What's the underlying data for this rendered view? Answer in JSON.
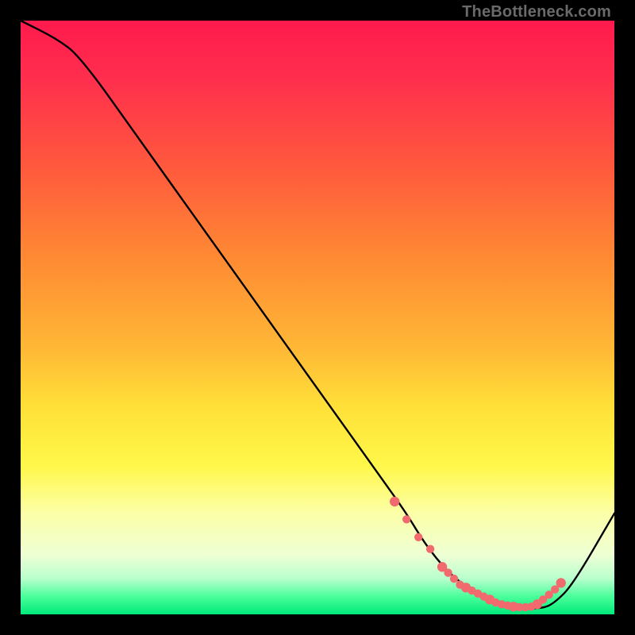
{
  "watermark": "TheBottleneck.com",
  "chart_data": {
    "type": "line",
    "title": "",
    "xlabel": "",
    "ylabel": "",
    "xlim": [
      0,
      100
    ],
    "ylim": [
      0,
      100
    ],
    "series": [
      {
        "name": "curve",
        "x": [
          0,
          6,
          10,
          20,
          30,
          40,
          50,
          60,
          65,
          68,
          72,
          76,
          80,
          84,
          88,
          90,
          93,
          100
        ],
        "y": [
          100,
          97,
          94,
          80,
          66,
          52,
          38,
          24,
          17,
          12,
          7,
          4,
          2,
          1,
          1,
          2,
          5,
          17
        ]
      }
    ],
    "markers": {
      "name": "dots",
      "color": "#f06a6e",
      "x": [
        63,
        65,
        67,
        69,
        71,
        72,
        73,
        74,
        75,
        76,
        77,
        78,
        79,
        80,
        81,
        82,
        83,
        84,
        85,
        86,
        87,
        88,
        89,
        90,
        91
      ],
      "y": [
        19,
        16,
        13,
        11,
        8,
        7,
        6,
        5,
        4.5,
        4,
        3.5,
        3,
        2.5,
        2,
        1.7,
        1.5,
        1.3,
        1.2,
        1.2,
        1.3,
        1.7,
        2.5,
        3.3,
        4.2,
        5.3
      ]
    }
  }
}
